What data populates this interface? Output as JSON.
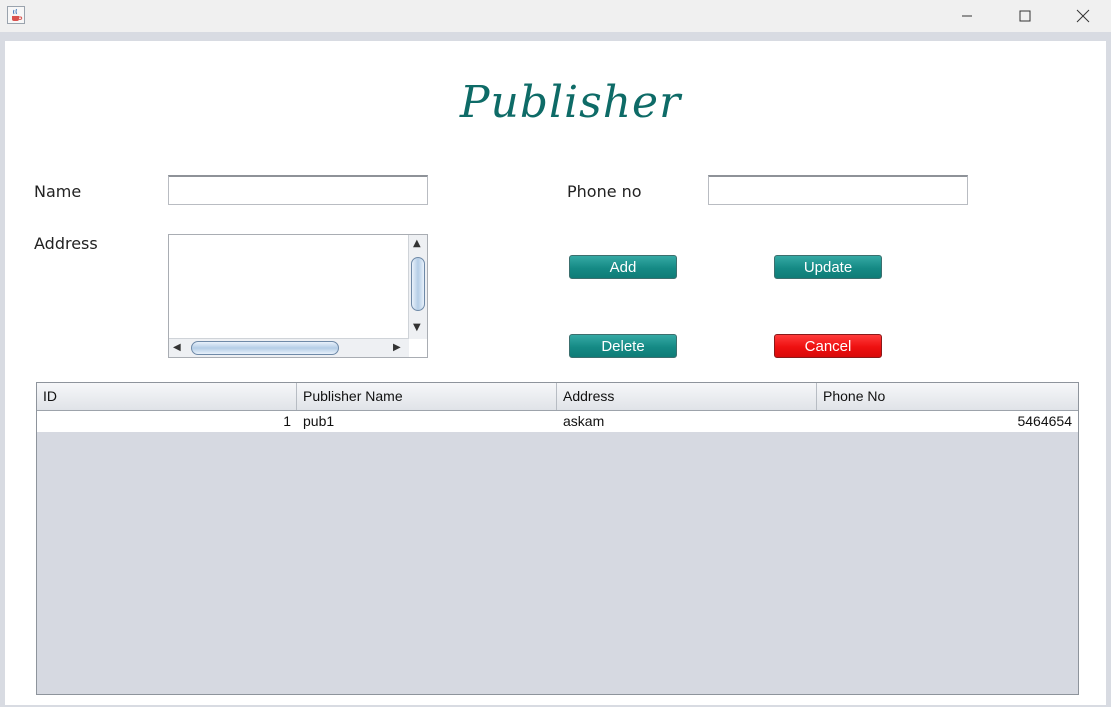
{
  "window": {
    "title": "",
    "icon": "java-cup-icon",
    "controls": [
      "minimize-icon",
      "maximize-icon",
      "close-icon"
    ]
  },
  "form": {
    "heading": "Publisher",
    "name_label": "Name",
    "name_value": "",
    "phone_label": "Phone no",
    "phone_value": "",
    "address_label": "Address",
    "address_value": ""
  },
  "buttons": {
    "add": "Add",
    "update": "Update",
    "delete": "Delete",
    "cancel": "Cancel"
  },
  "colors": {
    "heading": "#0e6b67",
    "teal_button": "#158a85",
    "cancel_button": "#ee1010"
  },
  "table": {
    "columns": [
      "ID",
      "Publisher Name",
      "Address",
      "Phone No"
    ],
    "rows": [
      {
        "id": "1",
        "name": "pub1",
        "address": "askam",
        "phone": "5464654"
      }
    ]
  }
}
